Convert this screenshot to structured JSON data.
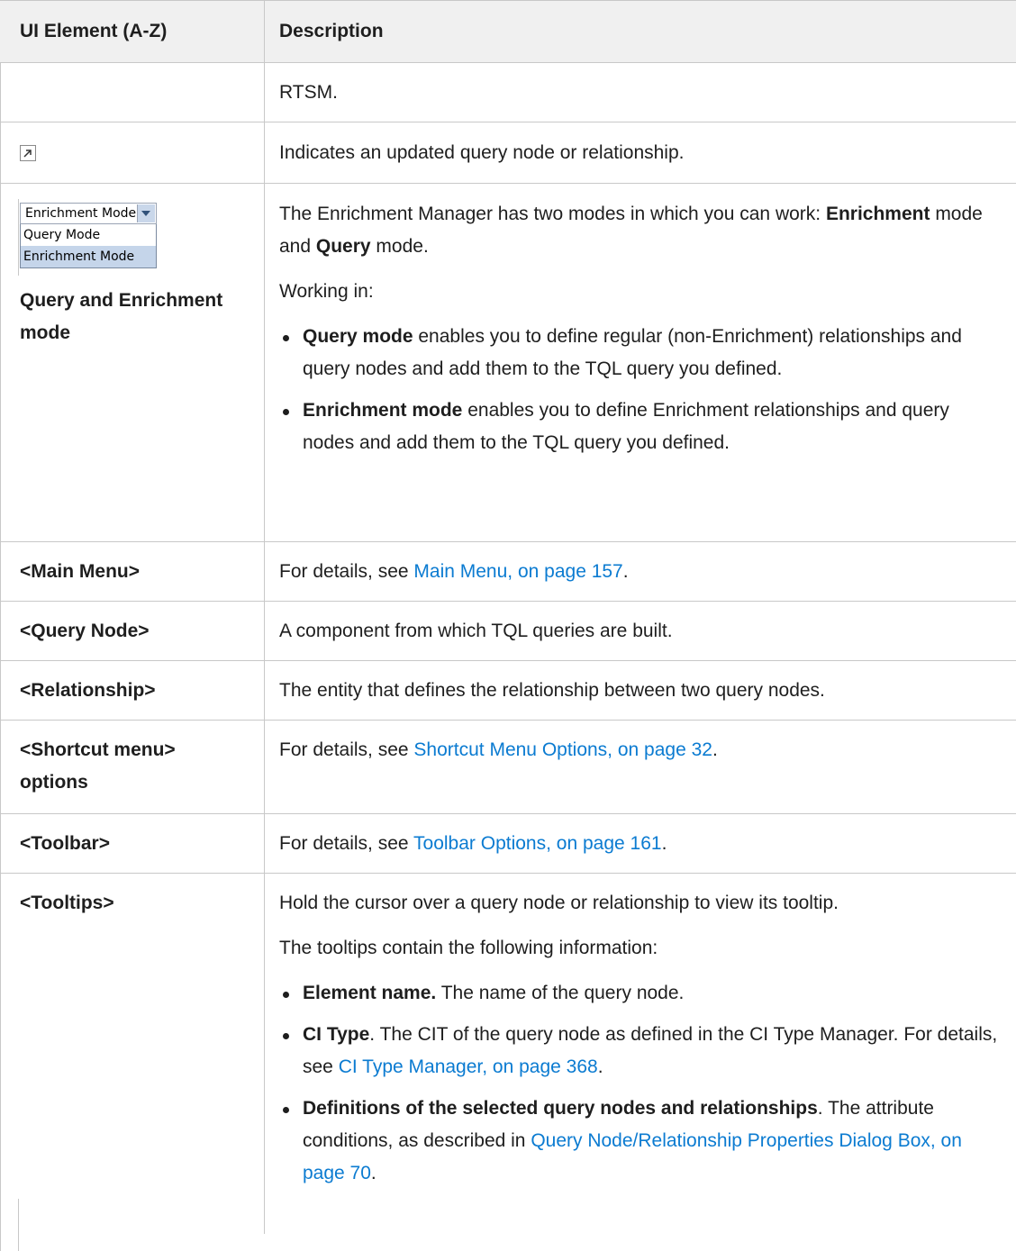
{
  "table": {
    "col1_header": "UI Element (A-Z)",
    "col2_header": "Description"
  },
  "rows": {
    "rtsm": {
      "desc": "RTSM."
    },
    "updated": {
      "icon": "updated-node-icon",
      "desc": "Indicates an updated query node or relationship."
    },
    "mode": {
      "widget_selected": "Enrichment Mode",
      "widget_options": [
        "Query Mode",
        "Enrichment Mode"
      ],
      "label": "Query and Enrichment mode",
      "intro_b1": "The Enrichment Manager has two modes in which you can work: ",
      "intro_bold1": "Enrichment",
      "intro_mid": " mode and ",
      "intro_bold2": "Query",
      "intro_end": " mode.",
      "working_in": "Working in:",
      "bullet1_bold": "Query mode",
      "bullet1_text": " enables you to define regular (non-Enrichment) relationships and query nodes and add them to the TQL query you defined.",
      "bullet2_bold": "Enrichment mode",
      "bullet2_text": " enables you to define Enrichment relationships and query nodes and add them to the TQL query you defined."
    },
    "main_menu": {
      "label": "<Main Menu>",
      "prefix": "For details, see ",
      "link": "Main Menu, on page 157",
      "suffix": "."
    },
    "query_node": {
      "label": "<Query Node>",
      "desc": "A component from which TQL queries are built."
    },
    "relationship": {
      "label": "<Relationship>",
      "desc": "The entity that defines the relationship between two query nodes."
    },
    "shortcut": {
      "label": "<Shortcut menu> options",
      "prefix": "For details, see ",
      "link": "Shortcut Menu Options, on page 32",
      "suffix": "."
    },
    "toolbar": {
      "label": "<Toolbar>",
      "prefix": "For details, see ",
      "link": "Toolbar Options, on page 161",
      "suffix": "."
    },
    "tooltips": {
      "label": "<Tooltips>",
      "p1": "Hold the cursor over a query node or relationship to view its tooltip.",
      "p2": "The tooltips contain the following information:",
      "b1_bold": "Element name.",
      "b1_text": " The name of the query node.",
      "b2_bold": "CI Type",
      "b2_text": ". The CIT of the query node as defined in the CI Type Manager. For details, see ",
      "b2_link": "CI Type Manager, on page 368",
      "b2_end": ".",
      "b3_bold": "Definitions of the selected query nodes and relationships",
      "b3_text": ". The attribute conditions, as described in ",
      "b3_link": "Query Node/Relationship Properties Dialog Box, on page 70",
      "b3_end": "."
    }
  }
}
